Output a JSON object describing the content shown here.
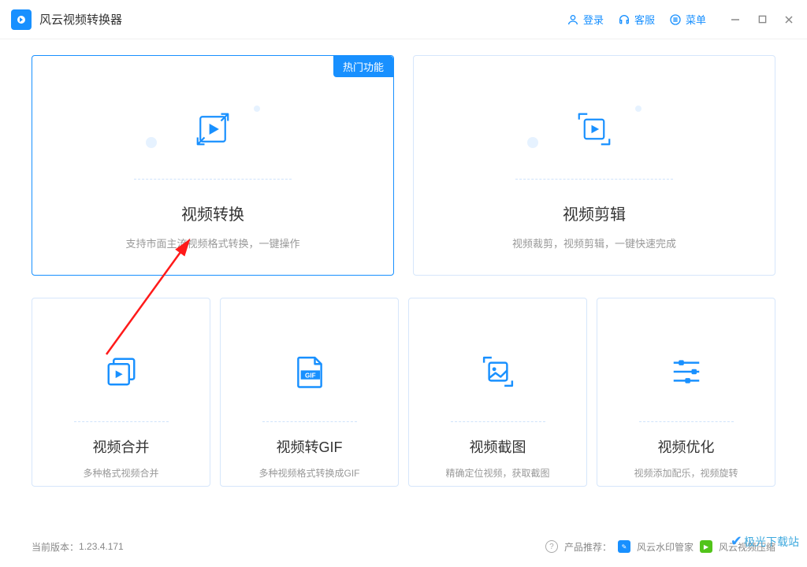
{
  "app": {
    "title": "风云视频转换器"
  },
  "titlebar": {
    "login": "登录",
    "support": "客服",
    "menu": "菜单"
  },
  "cards": {
    "convert": {
      "title": "视频转换",
      "desc": "支持市面主流视频格式转换，一键操作",
      "badge": "热门功能"
    },
    "edit": {
      "title": "视频剪辑",
      "desc": "视频裁剪，视频剪辑，一键快速完成"
    },
    "merge": {
      "title": "视频合并",
      "desc": "多种格式视频合并"
    },
    "gif": {
      "title": "视频转GIF",
      "desc": "多种视频格式转换成GIF",
      "gif_label": "GIF"
    },
    "shot": {
      "title": "视频截图",
      "desc": "精确定位视频，获取截图"
    },
    "opt": {
      "title": "视频优化",
      "desc": "视频添加配乐，视频旋转"
    }
  },
  "footer": {
    "version_label": "当前版本：",
    "version": "1.23.4.171",
    "recommend_label": "产品推荐：",
    "rec1": "风云水印管家",
    "rec2": "风云视频压缩"
  },
  "watermark": "极光下载站"
}
